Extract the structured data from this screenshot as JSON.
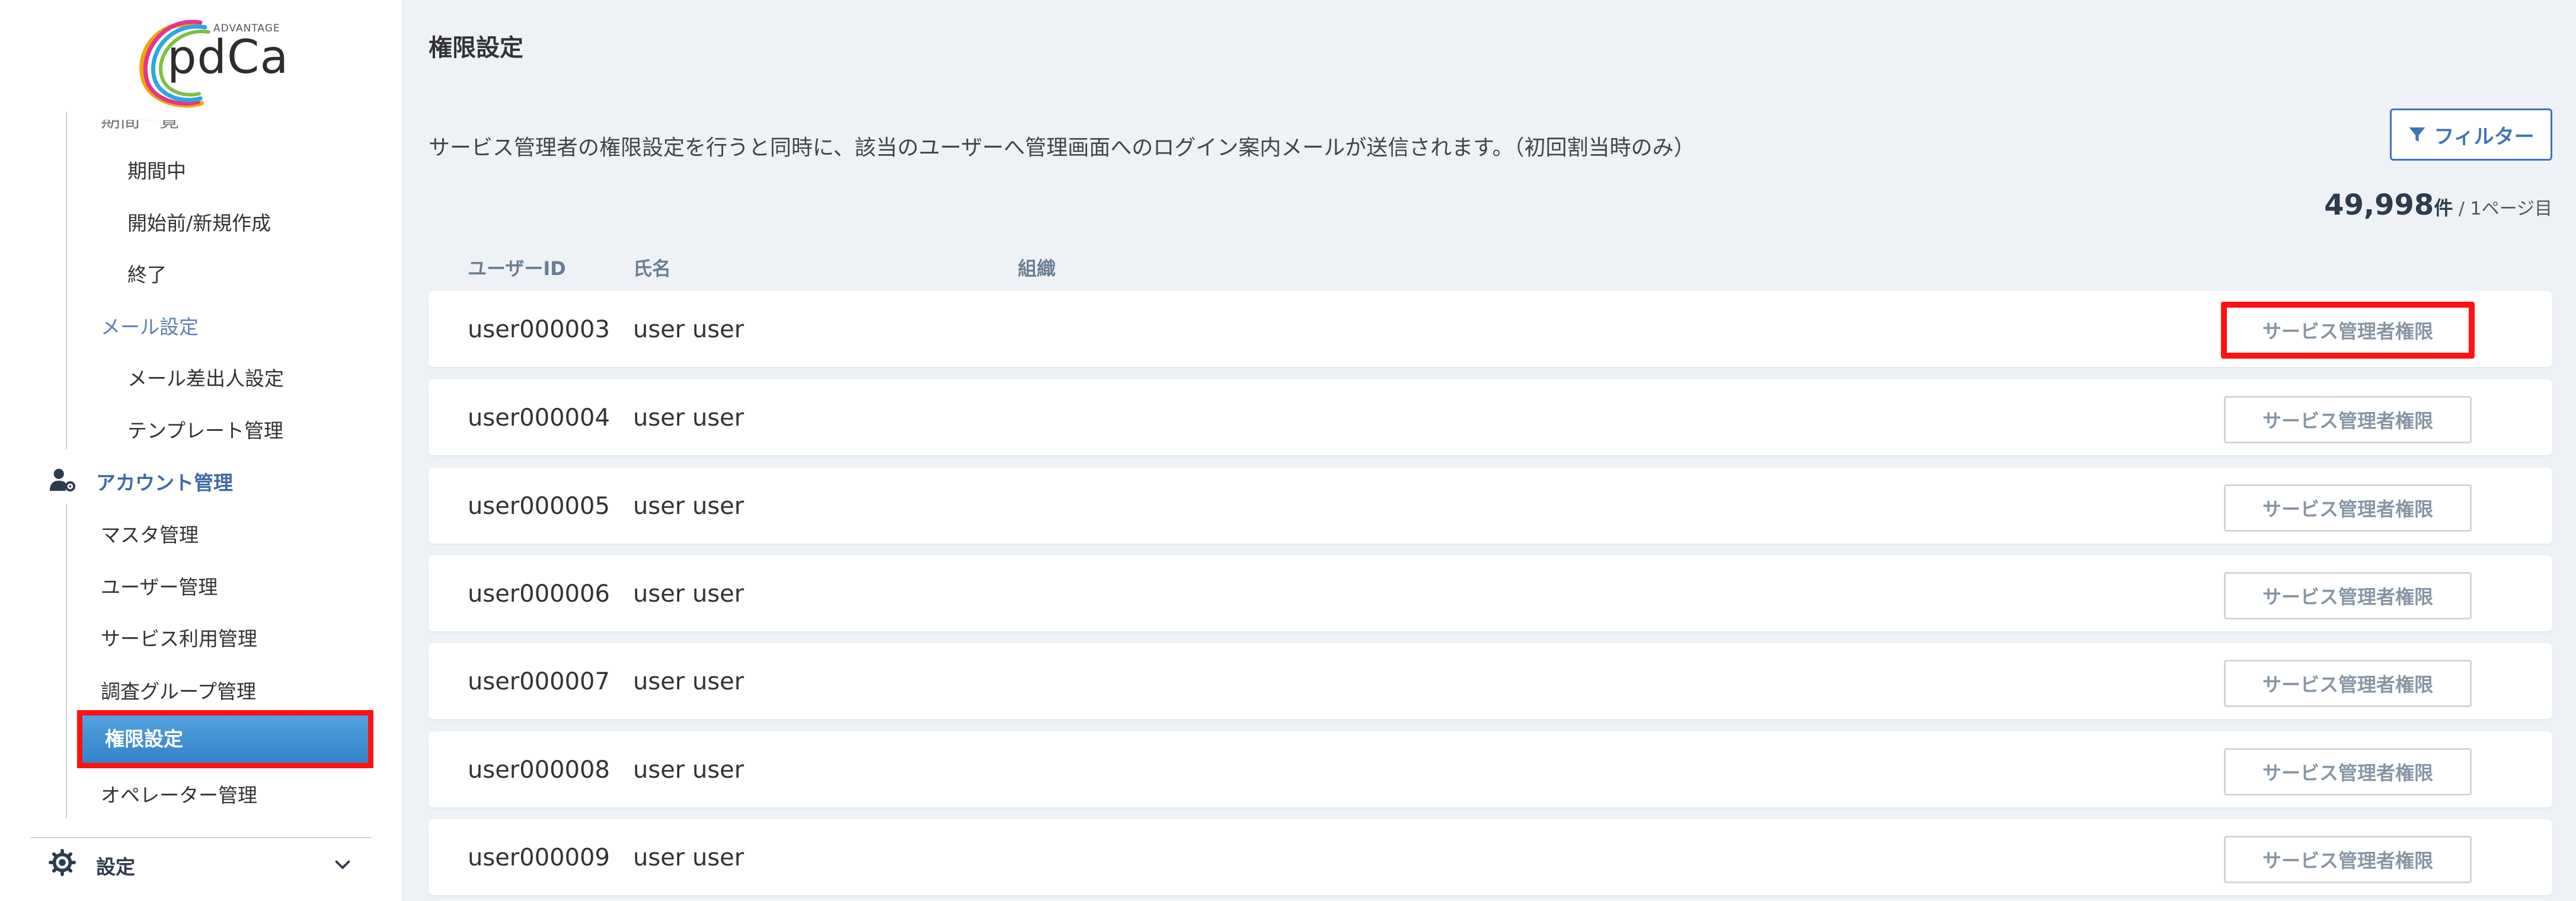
{
  "app": {
    "logo_text": "pdCa",
    "logo_small": "ADVANTAGE"
  },
  "sidebar": {
    "cut_text": "期間一覧",
    "items": [
      {
        "label": "期間中"
      },
      {
        "label": "開始前/新規作成"
      },
      {
        "label": "終了"
      },
      {
        "label": "メール設定"
      },
      {
        "label": "メール差出人設定"
      },
      {
        "label": "テンプレート管理"
      },
      {
        "label": "アカウント管理"
      },
      {
        "label": "マスタ管理"
      },
      {
        "label": "ユーザー管理"
      },
      {
        "label": "サービス利用管理"
      },
      {
        "label": "調査グループ管理"
      },
      {
        "label": "権限設定"
      },
      {
        "label": "オペレーター管理"
      },
      {
        "label": "設定"
      }
    ]
  },
  "main": {
    "title": "権限設定",
    "notice": "サービス管理者の権限設定を行うと同時に、該当のユーザーへ管理画面へのログイン案内メールが送信されます。（初回割当時のみ）",
    "filter_label": "フィルター",
    "count_value": "49,998",
    "count_unit": "件",
    "count_page": " / 1ページ目",
    "columns": {
      "user_id": "ユーザーID",
      "name": "氏名",
      "org": "組織"
    },
    "permission_label": "サービス管理者権限",
    "rows": [
      {
        "user_id": "user000003",
        "name": "user user",
        "org": ""
      },
      {
        "user_id": "user000004",
        "name": "user user",
        "org": ""
      },
      {
        "user_id": "user000005",
        "name": "user user",
        "org": ""
      },
      {
        "user_id": "user000006",
        "name": "user user",
        "org": ""
      },
      {
        "user_id": "user000007",
        "name": "user user",
        "org": ""
      },
      {
        "user_id": "user000008",
        "name": "user user",
        "org": ""
      },
      {
        "user_id": "user000009",
        "name": "user user",
        "org": ""
      }
    ]
  },
  "colors": {
    "accent": "#3f73bf",
    "active_nav_top": "#52a3e0",
    "active_nav_bottom": "#3582c8",
    "highlight": "#ff1111",
    "background": "#eef2f6"
  }
}
